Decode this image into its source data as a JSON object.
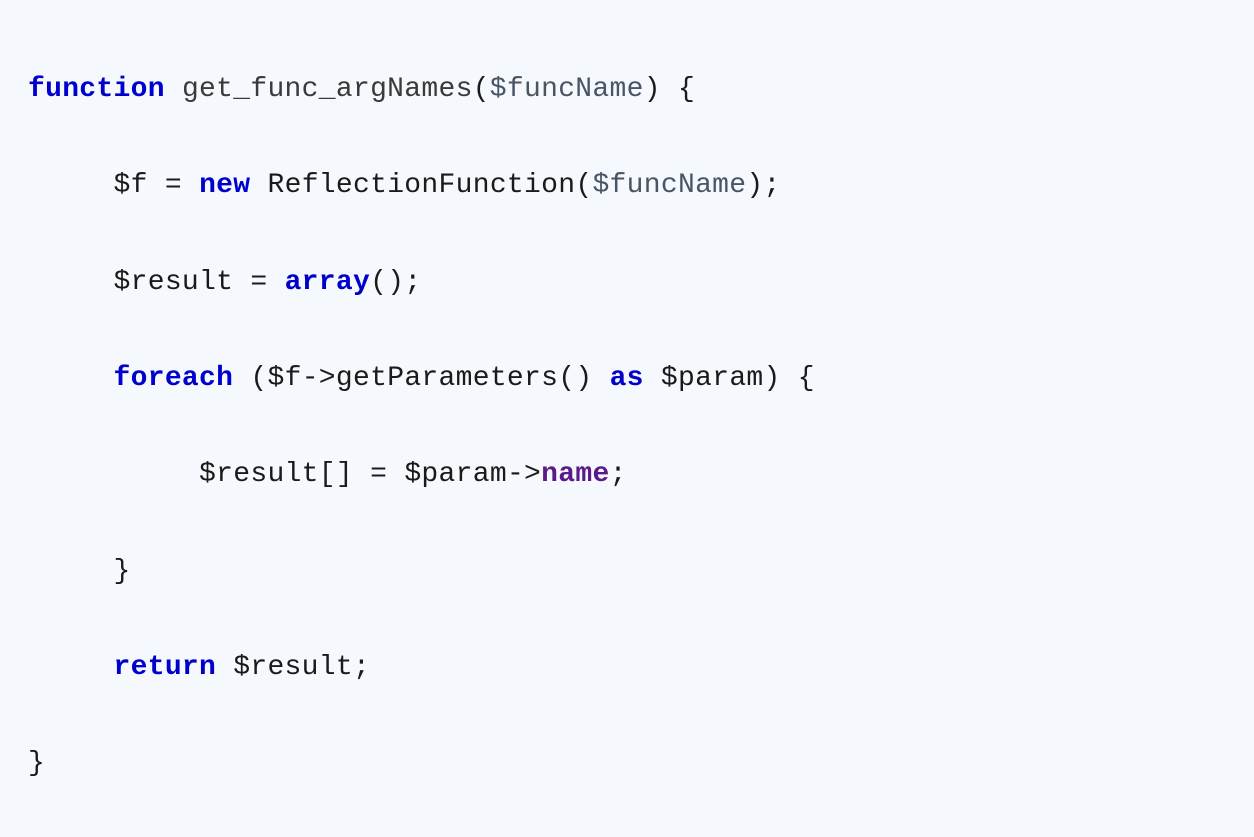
{
  "code": {
    "line1": {
      "kw_function": "function",
      "func_name": "get_func_argNames",
      "paren_open": "(",
      "param": "$funcName",
      "paren_close": ")",
      "brace_open": "{"
    },
    "line2": {
      "var_f": "$f",
      "eq": "=",
      "kw_new": "new",
      "class_name": "ReflectionFunction",
      "paren_open": "(",
      "param": "$funcName",
      "paren_close": ")",
      "semi": ";"
    },
    "line3": {
      "var_result": "$result",
      "eq": "=",
      "kw_array": "array",
      "parens": "()",
      "semi": ";"
    },
    "line4": {
      "kw_foreach": "foreach",
      "paren_open": "(",
      "var_f": "$f",
      "arrow": "->",
      "method": "getParameters",
      "parens": "()",
      "kw_as": "as",
      "var_param": "$param",
      "paren_close": ")",
      "brace_open": "{"
    },
    "line5": {
      "var_result": "$result",
      "brackets": "[]",
      "eq": "=",
      "var_param": "$param",
      "arrow": "->",
      "prop": "name",
      "semi": ";"
    },
    "line6": {
      "brace_close": "}"
    },
    "line7": {
      "kw_return": "return",
      "var_result": "$result",
      "semi": ";"
    },
    "line8": {
      "brace_close": "}"
    }
  }
}
